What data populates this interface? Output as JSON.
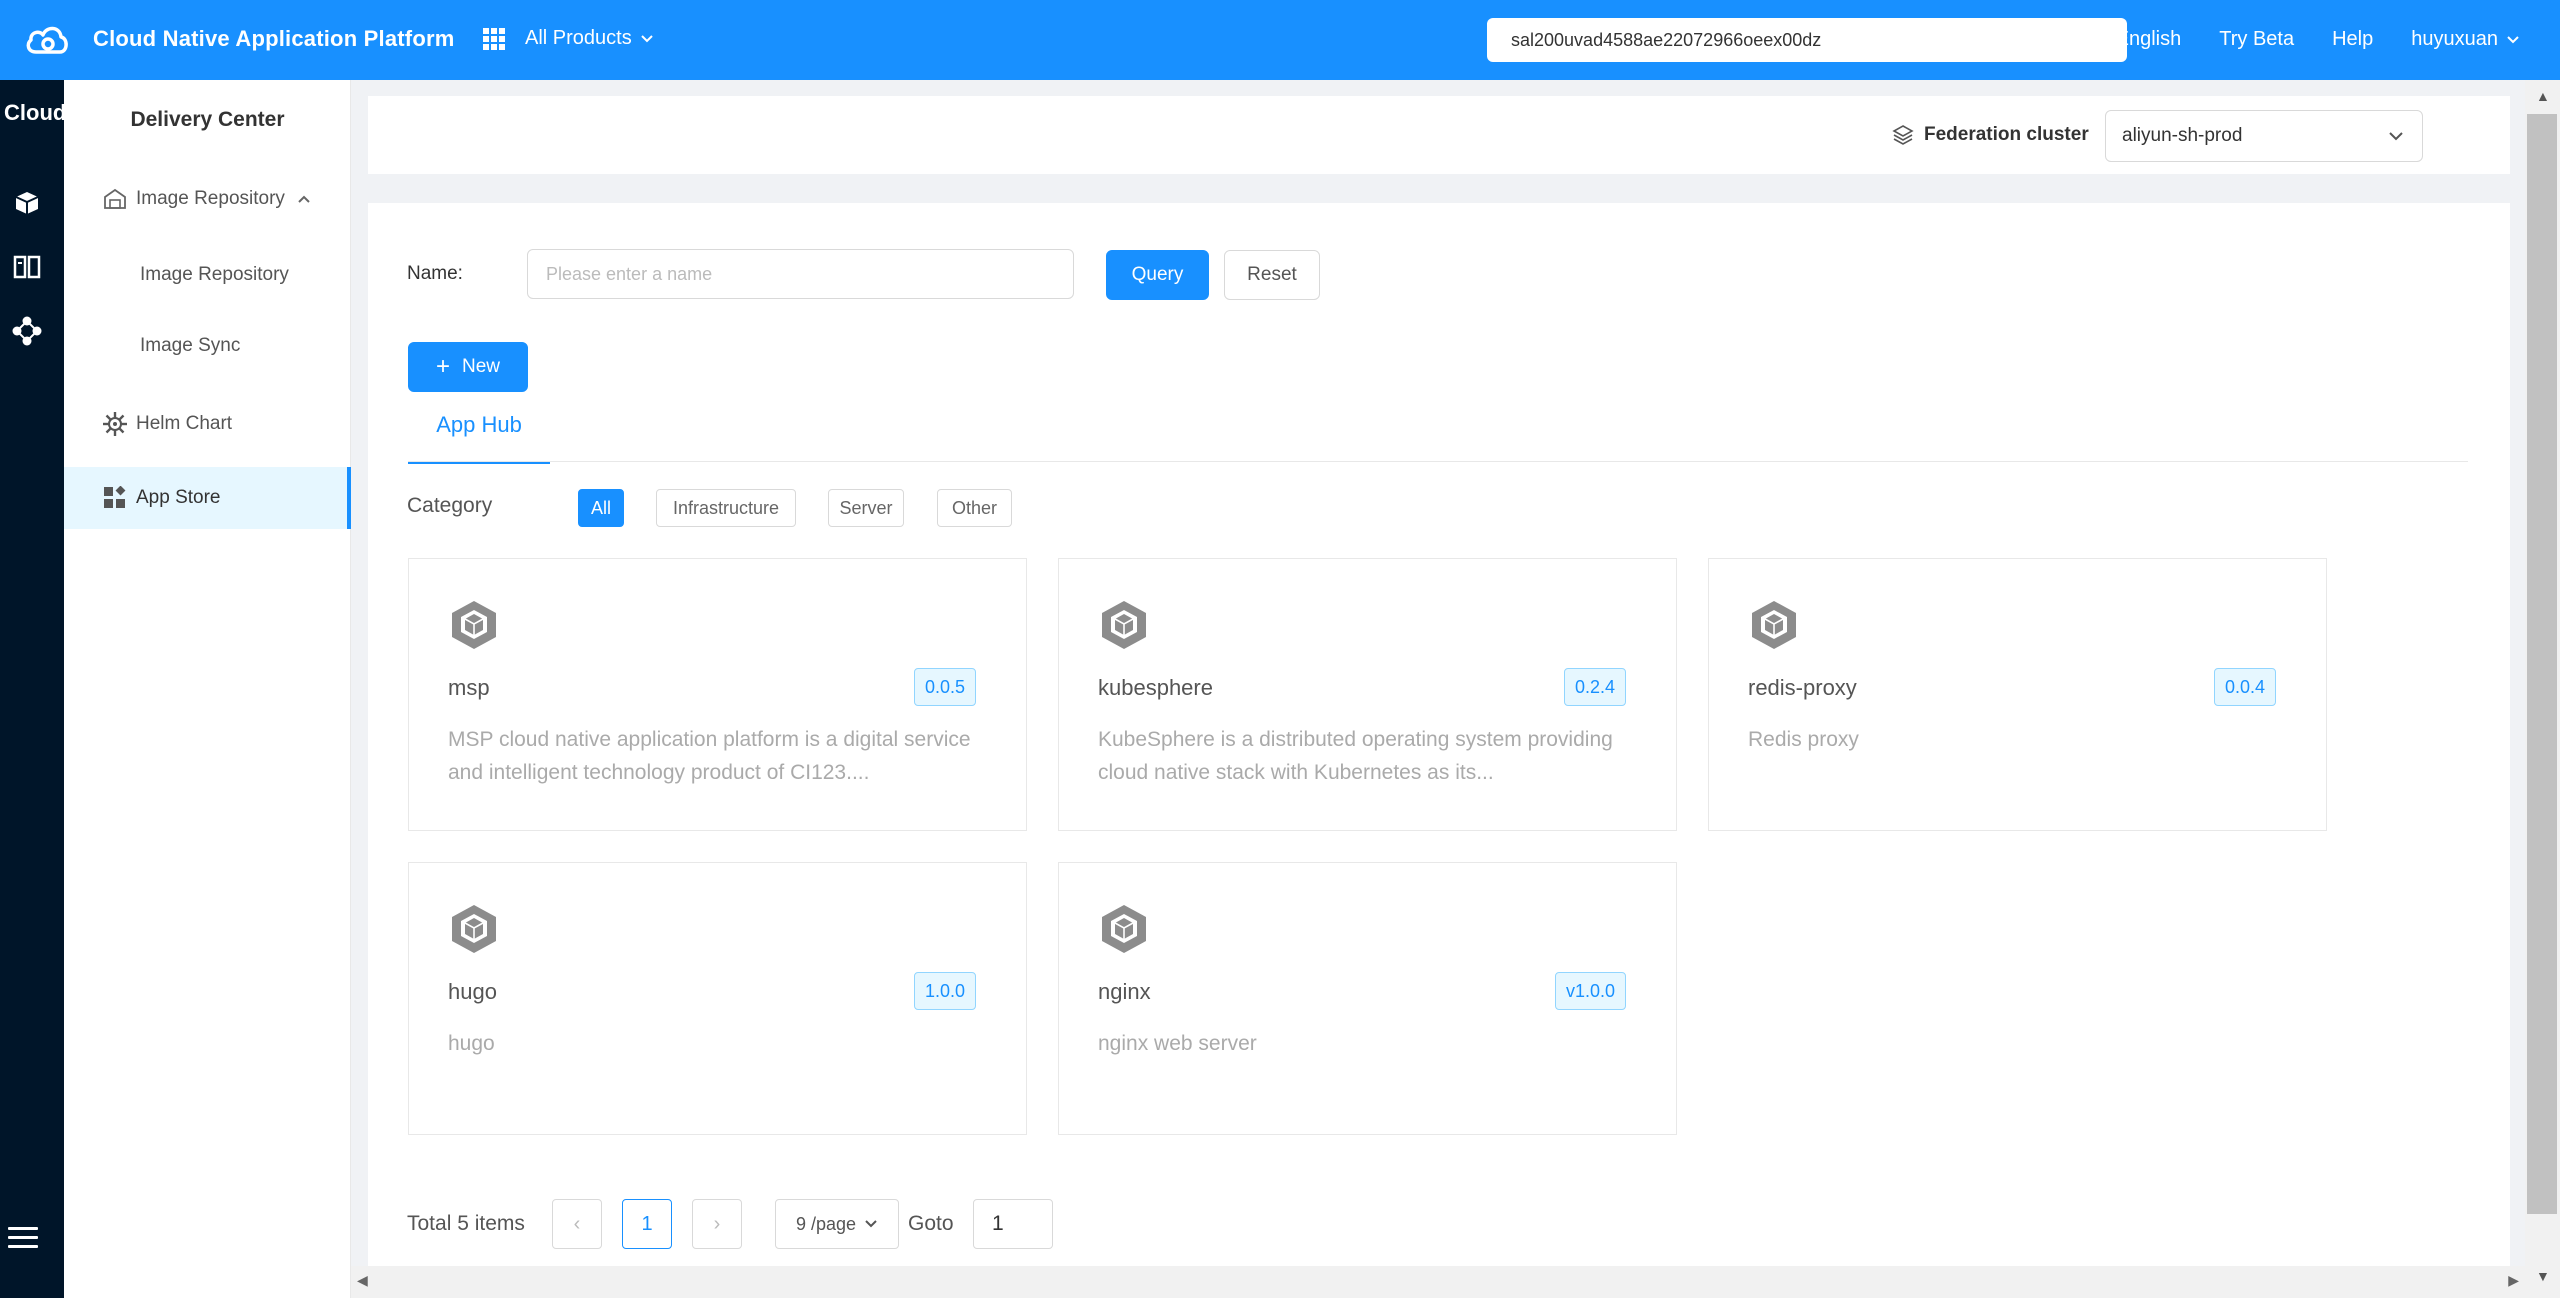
{
  "header": {
    "app_title": "Cloud Native Application Platform",
    "products_label": "All Products",
    "search_value": "sal200uvad4588ae22072966oeex00dz",
    "links": {
      "language": "English",
      "try_beta": "Try Beta",
      "help": "Help",
      "user": "huyuxuan"
    }
  },
  "rail": {
    "title": "Cloud",
    "icons": [
      "box-icon",
      "layout-icon",
      "cluster-icon"
    ],
    "menu_icon": "hamburger-icon"
  },
  "sidenav": {
    "title": "Delivery Center",
    "groups": [
      {
        "label": "Image Repository",
        "icon": "warehouse-icon",
        "expanded": true,
        "children": [
          "Image Repository",
          "Image Sync"
        ]
      },
      {
        "label": "Helm Chart",
        "icon": "helm-icon"
      },
      {
        "label": "App Store",
        "icon": "apps-icon",
        "active": true
      }
    ]
  },
  "cluster": {
    "label": "Federation cluster",
    "value": "aliyun-sh-prod"
  },
  "search_form": {
    "name_label": "Name:",
    "name_placeholder": "Please enter a name",
    "query_label": "Query",
    "reset_label": "Reset",
    "new_label": "New"
  },
  "tabs": [
    {
      "label": "App Hub",
      "active": true
    }
  ],
  "category": {
    "label": "Category",
    "options": [
      "All",
      "Infrastructure",
      "Server",
      "Other"
    ],
    "selected": "All"
  },
  "apps": [
    {
      "name": "msp",
      "version": "0.0.5",
      "description": "MSP cloud native application platform is a digital service and intelligent technology product of CI123...."
    },
    {
      "name": "kubesphere",
      "version": "0.2.4",
      "description": "KubeSphere is a distributed operating system providing cloud native stack with Kubernetes as its..."
    },
    {
      "name": "redis-proxy",
      "version": "0.0.4",
      "description": "Redis proxy"
    },
    {
      "name": "hugo",
      "version": "1.0.0",
      "description": "hugo"
    },
    {
      "name": "nginx",
      "version": "v1.0.0",
      "description": "nginx web server"
    }
  ],
  "pagination": {
    "total_text": "Total 5 items",
    "prev": "‹",
    "next": "›",
    "current_page": "1",
    "page_size": "9 /page",
    "goto_label": "Goto",
    "goto_value": "1"
  },
  "colors": {
    "primary": "#1890ff",
    "rail_bg": "#001529",
    "active_bg": "#e6f7ff"
  }
}
